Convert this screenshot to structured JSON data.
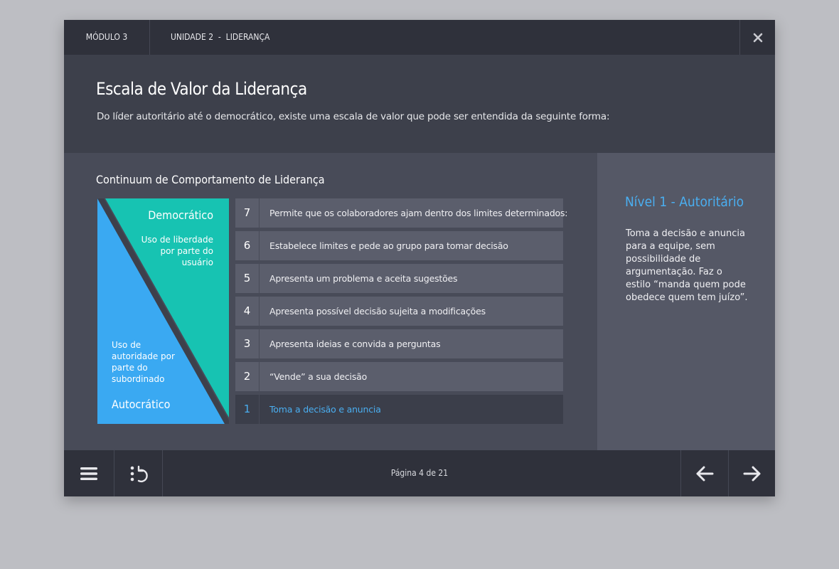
{
  "topbar": {
    "module": "MÓDULO 3",
    "unit": "UNIDADE 2  -  LIDERANÇA",
    "close_icon": "close-icon"
  },
  "header": {
    "title": "Escala de Valor da Liderança",
    "subtitle": "Do líder autoritário até o democrático, existe uma escala de valor que pode ser entendida da seguinte forma:"
  },
  "content": {
    "section_title": "Continuum de Comportamento de Liderança",
    "triangle": {
      "democratic_title": "Democrático",
      "democratic_desc": "Uso de liberdade por parte do usuário",
      "autocratic_desc": "Uso de autoridade por parte do subordinado",
      "autocratic_title": "Autocrático",
      "colors": {
        "democratic": "#17c3b2",
        "autocratic": "#3aa9f2",
        "divider": "#3d404b"
      }
    },
    "levels": [
      {
        "num": "7",
        "text": "Permite que os colaboradores ajam dentro dos limites determinados:"
      },
      {
        "num": "6",
        "text": "Estabelece limites e pede ao grupo para tomar decisão"
      },
      {
        "num": "5",
        "text": "Apresenta um problema e aceita sugestões"
      },
      {
        "num": "4",
        "text": "Apresenta possível decisão sujeita a modificações"
      },
      {
        "num": "3",
        "text": "Apresenta ideias e convida a perguntas"
      },
      {
        "num": "2",
        "text": "“Vende” a sua decisão"
      },
      {
        "num": "1",
        "text": "Toma a decisão e anuncia",
        "active": true
      }
    ]
  },
  "side_panel": {
    "title": "Nível 1 - Autoritário",
    "text": "Toma a decisão e anuncia para a equipe, sem possibilidade de argumentação. Faz o estilo “manda quem pode obedece quem tem juízo”."
  },
  "footer": {
    "page": "Página 4 de 21",
    "icons": [
      "menu-icon",
      "restart-icon",
      "arrow-left-icon",
      "arrow-right-icon"
    ]
  },
  "colors": {
    "accent": "#4aaef0"
  }
}
